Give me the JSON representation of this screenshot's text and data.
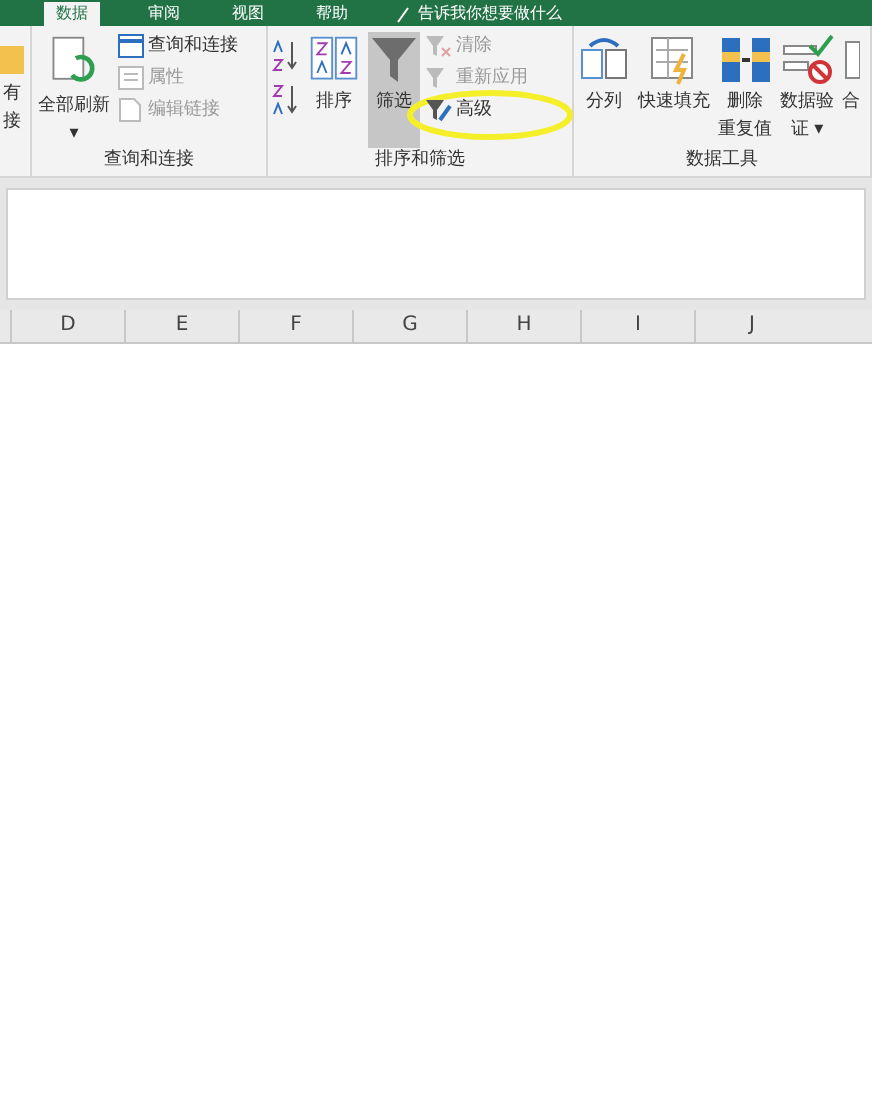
{
  "ribbon_tabs": [
    {
      "label": "数据",
      "selected": true
    },
    {
      "label": "审阅",
      "selected": false
    },
    {
      "label": "视图",
      "selected": false
    },
    {
      "label": "帮助",
      "selected": false
    }
  ],
  "tell_me": "告诉我你想要做什么",
  "groups": [
    {
      "items": [
        {
          "kind": "big",
          "lines": [
            "有",
            "接"
          ]
        }
      ]
    },
    {
      "label": "查询和连接",
      "items": [
        {
          "kind": "big",
          "lines": [
            "全部刷新",
            "▾"
          ]
        },
        {
          "kind": "stack",
          "children": [
            {
              "label": "查询和连接",
              "disabled": false
            },
            {
              "label": "属性",
              "disabled": true
            },
            {
              "label": "编辑链接",
              "disabled": true
            }
          ]
        }
      ]
    },
    {
      "label": "排序和筛选",
      "items": [
        {
          "kind": "sortstack"
        },
        {
          "kind": "big",
          "lines": [
            "排序"
          ],
          "selected": false
        },
        {
          "kind": "big",
          "lines": [
            "筛选"
          ],
          "selected": true
        },
        {
          "kind": "stack",
          "children": [
            {
              "label": "清除",
              "disabled": true
            },
            {
              "label": "重新应用",
              "disabled": true
            },
            {
              "label": "高级",
              "disabled": false
            }
          ]
        }
      ]
    },
    {
      "label": "数据工具",
      "items": [
        {
          "kind": "big",
          "lines": [
            "分列"
          ]
        },
        {
          "kind": "big",
          "lines": [
            "快速填充"
          ]
        },
        {
          "kind": "big",
          "lines": [
            "删除",
            "重复值"
          ]
        },
        {
          "kind": "big",
          "lines": [
            "数据验",
            "证 ▾"
          ]
        },
        {
          "kind": "big",
          "lines": [
            "合"
          ]
        }
      ]
    }
  ],
  "columns": [
    "D",
    "E",
    "F",
    "G",
    "H",
    "I",
    "J"
  ]
}
